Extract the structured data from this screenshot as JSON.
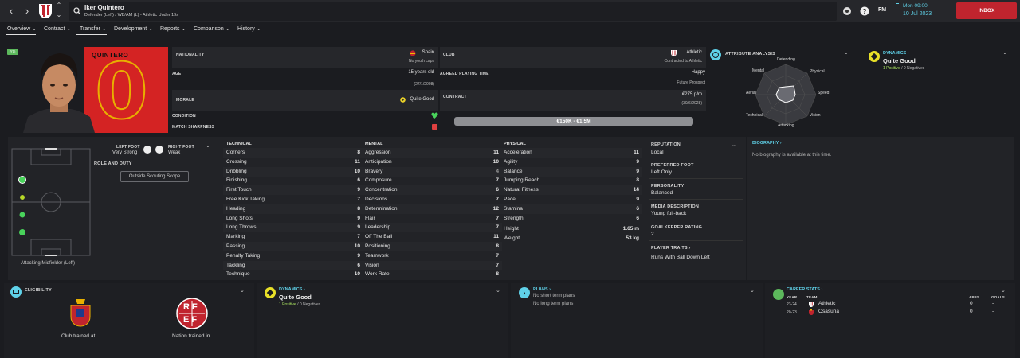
{
  "header": {
    "player_name": "Iker Quintero",
    "player_sub": "Defender (Left) / WB/AM (L) - Athletic Under 19s",
    "fm": "FM",
    "time": "Mon 09:00",
    "date": "10 Jul 2023",
    "inbox": "INBOX",
    "accent": "#c0242e"
  },
  "tabs": [
    {
      "label": "Overview"
    },
    {
      "label": "Contract"
    },
    {
      "label": "Transfer"
    },
    {
      "label": "Development"
    },
    {
      "label": "Reports"
    },
    {
      "label": "Comparison"
    },
    {
      "label": "History"
    }
  ],
  "profile": {
    "badge_tag": "Yth",
    "shirt_name": "QUINTERO",
    "shirt_number": "0"
  },
  "info": {
    "nationality_label": "NATIONALITY",
    "nationality": "Spain",
    "nationality_sub": "No youth caps",
    "age_label": "AGE",
    "age": "15 years old",
    "dob": "(27/1/2008)",
    "morale_label": "MORALE",
    "morale": "Quite Good",
    "condition_label": "CONDITION",
    "sharpness_label": "MATCH SHARPNESS",
    "club_label": "CLUB",
    "club": "Athletic",
    "club_sub": "Contracted to Athletic",
    "playing_time_label": "AGREED PLAYING TIME",
    "playing_time": "Happy",
    "playing_time_sub": "Future Prospect",
    "contract_label": "CONTRACT",
    "wage": "€275 p/m",
    "contract_end": "(30/6/2028)",
    "value": "€150K - €1.5M"
  },
  "attr_analysis": {
    "title": "ATTRIBUTE ANALYSIS",
    "axes": [
      "Defending",
      "Physical",
      "Speed",
      "Vision",
      "Attacking",
      "Technical",
      "Aerial",
      "Mental"
    ]
  },
  "dynamics_top": {
    "title": "DYNAMICS",
    "value": "Quite Good",
    "positives": "1 Positive",
    "slash": "/",
    "negatives": "0 Negatives"
  },
  "position": {
    "left_foot_label": "LEFT FOOT",
    "left_foot": "Very Strong",
    "right_foot_label": "RIGHT FOOT",
    "right_foot": "Weak",
    "role_label": "ROLE AND DUTY",
    "scouting": "Outside Scouting Scope",
    "role_text": "Attacking Midfielder (Left)"
  },
  "technical": {
    "title": "TECHNICAL",
    "rows": [
      {
        "n": "Corners",
        "v": "8"
      },
      {
        "n": "Crossing",
        "v": "11"
      },
      {
        "n": "Dribbling",
        "v": "10"
      },
      {
        "n": "Finishing",
        "v": "6"
      },
      {
        "n": "First Touch",
        "v": "9"
      },
      {
        "n": "Free Kick Taking",
        "v": "7"
      },
      {
        "n": "Heading",
        "v": "8"
      },
      {
        "n": "Long Shots",
        "v": "9"
      },
      {
        "n": "Long Throws",
        "v": "9"
      },
      {
        "n": "Marking",
        "v": "7"
      },
      {
        "n": "Passing",
        "v": "10"
      },
      {
        "n": "Penalty Taking",
        "v": "9"
      },
      {
        "n": "Tackling",
        "v": "6"
      },
      {
        "n": "Technique",
        "v": "10"
      }
    ]
  },
  "mental": {
    "title": "MENTAL",
    "rows": [
      {
        "n": "Aggression",
        "v": "11"
      },
      {
        "n": "Anticipation",
        "v": "10"
      },
      {
        "n": "Bravery",
        "v": "4"
      },
      {
        "n": "Composure",
        "v": "7"
      },
      {
        "n": "Concentration",
        "v": "6"
      },
      {
        "n": "Decisions",
        "v": "7"
      },
      {
        "n": "Determination",
        "v": "12"
      },
      {
        "n": "Flair",
        "v": "7"
      },
      {
        "n": "Leadership",
        "v": "7"
      },
      {
        "n": "Off The Ball",
        "v": "11"
      },
      {
        "n": "Positioning",
        "v": "8"
      },
      {
        "n": "Teamwork",
        "v": "7"
      },
      {
        "n": "Vision",
        "v": "7"
      },
      {
        "n": "Work Rate",
        "v": "8"
      }
    ]
  },
  "physical": {
    "title": "PHYSICAL",
    "rows": [
      {
        "n": "Acceleration",
        "v": "11"
      },
      {
        "n": "Agility",
        "v": "9"
      },
      {
        "n": "Balance",
        "v": "9"
      },
      {
        "n": "Jumping Reach",
        "v": "8"
      },
      {
        "n": "Natural Fitness",
        "v": "14"
      },
      {
        "n": "Pace",
        "v": "9"
      },
      {
        "n": "Stamina",
        "v": "6"
      },
      {
        "n": "Strength",
        "v": "6"
      }
    ],
    "height_label": "Height",
    "height": "1.65 m",
    "weight_label": "Weight",
    "weight": "53 kg"
  },
  "details": {
    "reputation_label": "REPUTATION",
    "reputation": "Local",
    "foot_label": "PREFERRED FOOT",
    "foot": "Left Only",
    "personality_label": "PERSONALITY",
    "personality": "Balanced",
    "media_label": "MEDIA DESCRIPTION",
    "media": "Young full-back",
    "gk_label": "GOALKEEPER RATING",
    "gk": "2",
    "traits_label": "PLAYER TRAITS",
    "traits": "Runs With Ball Down Left"
  },
  "biography": {
    "title": "BIOGRAPHY",
    "text": "No biography is available at this time."
  },
  "eligibility": {
    "title": "ELIGIBILITY",
    "club_label": "Club trained at",
    "nation_label": "Nation trained in",
    "rfef_top": "RF",
    "rfef_bot": "EF"
  },
  "dynamics_bottom": {
    "title": "DYNAMICS",
    "value": "Quite Good",
    "positives": "1 Positive",
    "slash": "/",
    "negatives": "0 Negatives"
  },
  "plans": {
    "title": "PLANS",
    "short": "No short term plans",
    "long": "No long term plans"
  },
  "career": {
    "title": "CAREER STATS",
    "year_h": "YEAR",
    "team_h": "TEAM",
    "apps_h": "APPS",
    "goals_h": "GOALS",
    "rows": [
      {
        "year": "23-24",
        "team": "Athletic",
        "apps": "0",
        "goals": "-"
      },
      {
        "year": "20-23",
        "team": "Osasuna",
        "apps": "0",
        "goals": "-"
      }
    ]
  }
}
